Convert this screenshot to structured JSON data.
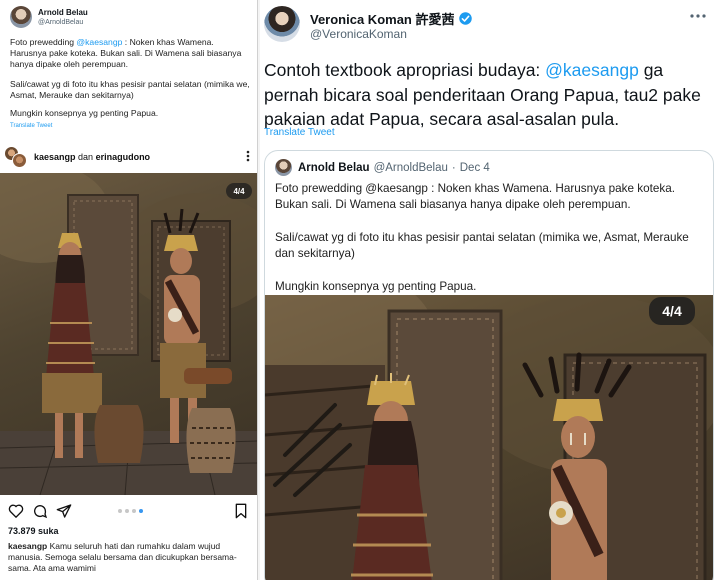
{
  "left_tweet": {
    "author_name": "Arnold Belau",
    "author_handle": "@ArnoldBelau",
    "text_prefix": "Foto prewedding ",
    "mention": "@kaesangp",
    "text_line1_rest": " : Noken khas Wamena. Harusnya pake koteka. Bukan sali. Di Wamena sali biasanya hanya dipake oleh perempuan.",
    "paragraph2": "Sali/cawat yg di foto itu khas pesisir pantai selatan (mimika we, Asmat, Merauke dan sekitarnya)",
    "paragraph3": "Mungkin konsepnya yg penting Papua.",
    "translate": "Translate Tweet"
  },
  "instagram": {
    "user1": "kaesangp",
    "connector": " dan ",
    "user2": "erinagudono",
    "badge": "4/4",
    "likes": "73.879 suka",
    "caption_user": "kaesangp",
    "caption_text": " Kamu seluruh hati dan rumahku dalam wujud manusia. Semoga selalu bersama dan dicukupkan bersama-sama. Ata ama wamimi",
    "dots_total": 4,
    "dots_active": 4
  },
  "right_tweet": {
    "author_name": "Veronica Koman 許愛茜",
    "author_handle": "@VeronicaKoman",
    "text_prefix": "Contoh textbook apropriasi budaya: ",
    "mention": "@kaesangp",
    "text_rest": " ga pernah bicara soal penderitaan Orang Papua, tau2 pake pakaian adat Papua, secara asal-asalan pula.",
    "translate": "Translate Tweet"
  },
  "quote_tweet": {
    "author_name": "Arnold Belau",
    "author_handle": "@ArnoldBelau",
    "separator": "·",
    "date": "Dec 4",
    "paragraph1": "Foto prewedding @kaesangp : Noken khas Wamena. Harusnya pake koteka. Bukan sali. Di Wamena sali biasanya hanya dipake oleh perempuan.",
    "paragraph2": "Sali/cawat yg di foto itu khas pesisir pantai selatan (mimika we, Asmat, Merauke dan sekitarnya)",
    "paragraph3": "Mungkin konsepnya yg penting Papua.",
    "badge": "4/4"
  },
  "colors": {
    "link": "#1d9bf0",
    "verified": "#1d9bf0",
    "text": "#0f1419",
    "muted": "#536471",
    "ig_dot_active": "#3897f0"
  },
  "icons": [
    "more-horizontal-icon",
    "verified-badge-icon",
    "heart-icon",
    "comment-icon",
    "share-icon",
    "bookmark-icon"
  ]
}
